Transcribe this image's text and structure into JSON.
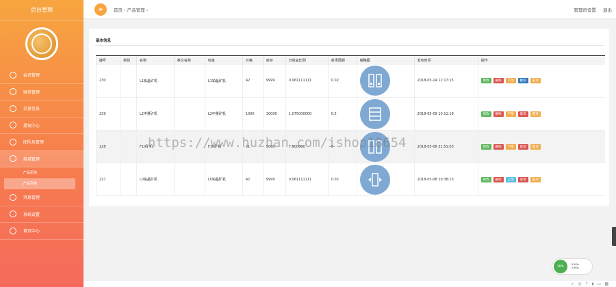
{
  "app": {
    "title": "后台管理"
  },
  "sidebar": {
    "items": [
      {
        "label": "会员管理",
        "icon": "diamond-icon"
      },
      {
        "label": "财务管理",
        "icon": "yen-icon"
      },
      {
        "label": "交易信息",
        "icon": "calendar-icon"
      },
      {
        "label": "提现中心",
        "icon": "wallet-icon"
      },
      {
        "label": "团队及管理",
        "icon": "chat-icon"
      },
      {
        "label": "商城管理",
        "icon": "shop-icon",
        "active": true
      },
      {
        "label": "消息管理",
        "icon": "message-icon"
      },
      {
        "label": "系统设置",
        "icon": "gear-icon"
      },
      {
        "label": "首页中心",
        "icon": "home-icon"
      }
    ],
    "sub_items": [
      {
        "label": "产品添加"
      },
      {
        "label": "产品列表",
        "active": true
      }
    ]
  },
  "header": {
    "breadcrumb": "首页 › 产品管理 ›",
    "admin_label": "管理员设置",
    "logout_label": "退出"
  },
  "panel": {
    "title": "基本信息",
    "columns": [
      "编号",
      "类别",
      "名称",
      "英文名称",
      "标签",
      "价格",
      "库存",
      "日收益比例",
      "封闭周期",
      "缩略图",
      "发布时间",
      "操作"
    ],
    "rows": [
      {
        "id": "230",
        "category": "",
        "name": "L1铂晶矿机",
        "en_name": "",
        "tag": "L1铂晶矿机",
        "price": "42",
        "stock": "9999",
        "ratio": "0.061111111",
        "cycle": "0.02",
        "time": "2018-05-14 12:17:15",
        "ops": [
          "修改",
          "删除",
          "下架",
          "推荐",
          "置顶"
        ]
      },
      {
        "id": "229",
        "category": "",
        "name": "L2中量矿机",
        "en_name": "",
        "tag": "L2中量矿机",
        "price": "1000",
        "stock": "10000",
        "ratio": "1.075000000",
        "cycle": "0.5",
        "time": "2018-05-09 10:11:18",
        "ops": [
          "修改",
          "删除",
          "下架",
          "取消",
          "置顶"
        ]
      },
      {
        "id": "228",
        "category": "",
        "name": "F10矿机",
        "en_name": "",
        "tag": "F10矿机",
        "price": "21",
        "stock": "5000",
        "ratio": "7.500000",
        "cycle": "0",
        "time": "2018-05-08 21:51:03",
        "ops": [
          "修改",
          "删除",
          "下架",
          "取消",
          "置顶"
        ]
      },
      {
        "id": "227",
        "category": "",
        "name": "L0铂晶矿机",
        "en_name": "",
        "tag": "L0铂晶矿机",
        "price": "42",
        "stock": "9999",
        "ratio": "0.061111111",
        "cycle": "0.02",
        "time": "2018-05-08 20:38:15",
        "ops": [
          "修改",
          "删除",
          "上架",
          "取消",
          "置顶"
        ]
      }
    ]
  },
  "watermark": "https://www.huzhan.com/ishop18654",
  "float_widget": {
    "percent": "38%",
    "up": "0.4K/s",
    "down": "4.8K/s"
  },
  "colors": {
    "accent": "#f7a53f",
    "edit": "#5cb85c",
    "delete": "#d9534f",
    "warn": "#f0ad4e",
    "blue": "#337ab7",
    "cyan": "#5bc0de"
  }
}
